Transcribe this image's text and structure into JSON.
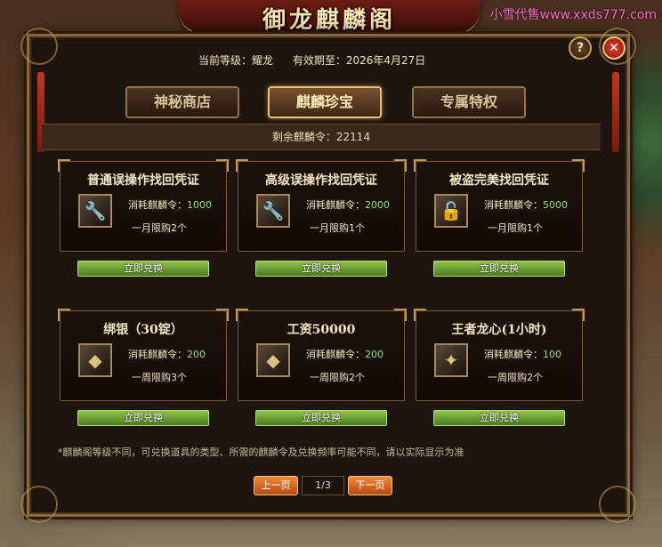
{
  "watermark": "小雪代售www.xxds777.com",
  "window_title": "御龙麒麟阁",
  "info": {
    "level_label": "当前等级：耀龙",
    "expire_label": "有效期至：2026年4月27日"
  },
  "tabs": [
    {
      "label": "神秘商店"
    },
    {
      "label": "麒麟珍宝"
    },
    {
      "label": "专属特权"
    }
  ],
  "remaining": "剩余麒麟令：22114",
  "items": [
    {
      "title": "普通误操作找回凭证",
      "cost_label": "消耗麒麟令：",
      "cost": "1000",
      "limit": "一月限购2个",
      "icon": "wrench-icon",
      "glyph": "🔧"
    },
    {
      "title": "高级误操作找回凭证",
      "cost_label": "消耗麒麟令：",
      "cost": "2000",
      "limit": "一月限购1个",
      "icon": "wrench-icon",
      "glyph": "🔧"
    },
    {
      "title": "被盗完美找回凭证",
      "cost_label": "消耗麒麟令：",
      "cost": "5000",
      "limit": "一月限购1个",
      "icon": "lock-icon",
      "glyph": "🔓"
    },
    {
      "title": "绑银（30锭）",
      "cost_label": "消耗麒麟令：",
      "cost": "200",
      "limit": "一周限购3个",
      "icon": "silver-ingot-icon",
      "glyph": "◆"
    },
    {
      "title": "工资50000",
      "cost_label": "消耗麒麟令：",
      "cost": "200",
      "limit": "一周限购2个",
      "icon": "gold-ingot-icon",
      "glyph": "◆"
    },
    {
      "title": "王者龙心(1小时)",
      "cost_label": "消耗麒麟令：",
      "cost": "100",
      "limit": "一周限购2个",
      "icon": "dragon-heart-icon",
      "glyph": "✦"
    }
  ],
  "redeem_label": "立即兑换",
  "note": "*麒麟阁等级不同，可兑换道具的类型、所需的麒麟令及兑换频率可能不同，请以实际显示为准",
  "pager": {
    "prev": "上一页",
    "page": "1/3",
    "next": "下一页"
  },
  "colors": {
    "cost_value": "#8ee07a",
    "accent_gold": "#c79a50",
    "redeem_green": "#6aa032"
  }
}
